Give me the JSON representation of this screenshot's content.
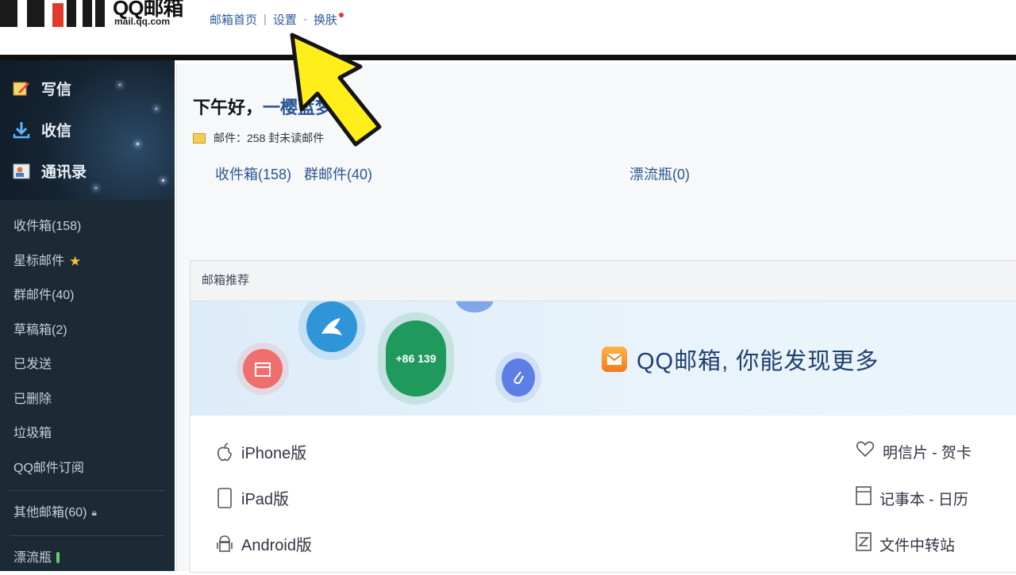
{
  "header": {
    "logo_text": "QQ邮箱",
    "logo_sub": "mail.qq.com",
    "nav": [
      "邮箱首页",
      "设置",
      "换肤"
    ],
    "nav_sep_1": "|",
    "nav_sep_2": "-"
  },
  "sidebar": {
    "top_items": [
      {
        "label": "写信",
        "icon": "compose-icon"
      },
      {
        "label": "收信",
        "icon": "download-icon"
      },
      {
        "label": "通讯录",
        "icon": "contacts-icon"
      }
    ],
    "folders": [
      "收件箱(158)",
      "星标邮件",
      "群邮件(40)",
      "草稿箱(2)",
      "已发送",
      "已删除",
      "垃圾箱",
      "QQ邮件订阅"
    ],
    "other": "其他邮箱(60)",
    "last": "漂流瓶"
  },
  "main": {
    "greeting": "下午好，",
    "user_name": "一樱蓝梦",
    "mail_info": "邮件：258 封未读邮件",
    "links": [
      "收件箱(158)",
      "群邮件(40)"
    ],
    "drift": "漂流瓶(0)",
    "rec_header": "邮箱推荐",
    "slogan": "QQ邮箱, 你能发现更多",
    "phone_bubble": "+86 139",
    "apps": [
      "iPhone版",
      "iPad版",
      "Android版"
    ],
    "tools": [
      "明信片 - 贺卡",
      "记事本 - 日历",
      "文件中转站"
    ]
  },
  "colors": {
    "link": "#2a5693",
    "sidebar_bg": "#1c2a36",
    "arrow": "#ffee1a"
  }
}
